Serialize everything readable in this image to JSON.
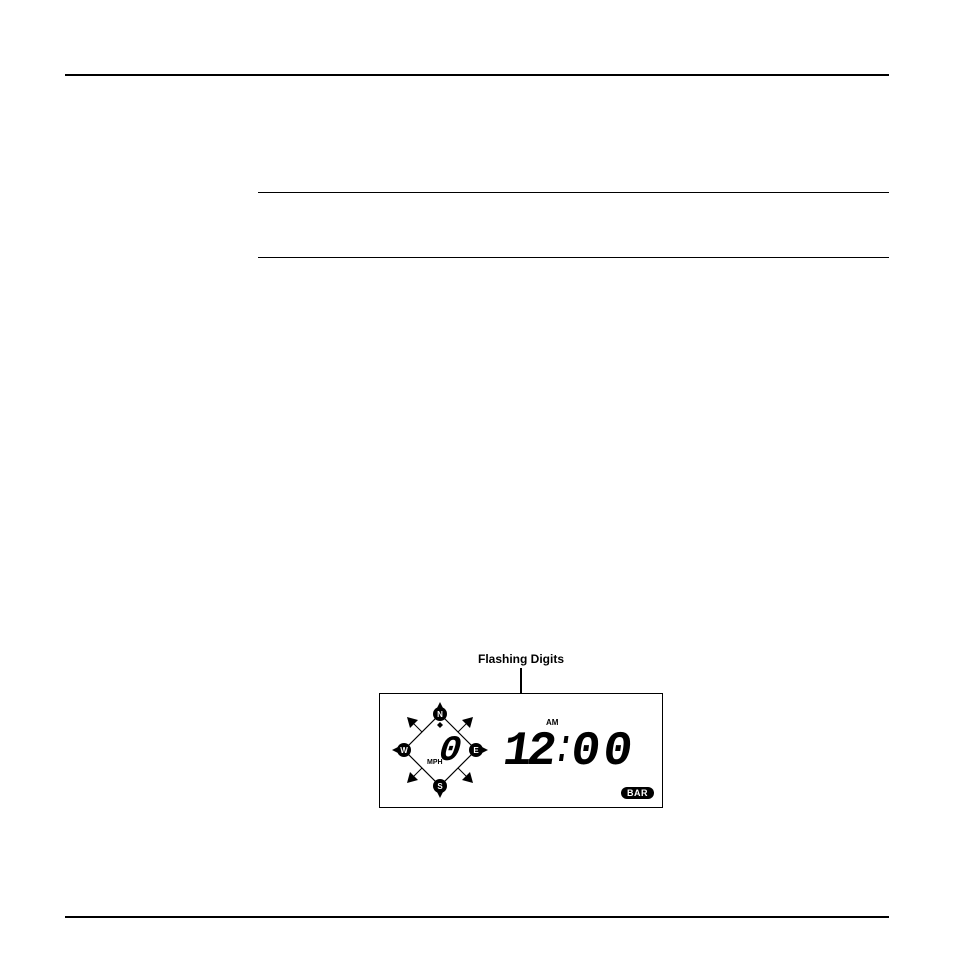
{
  "diagram": {
    "caption": "Flashing Digits",
    "time": "12:00",
    "ampm": "AM",
    "speed_value": "0",
    "speed_unit": "MPH",
    "compass_letters": {
      "n": "N",
      "e": "E",
      "s": "S",
      "w": "W"
    },
    "badge": "BAR"
  }
}
